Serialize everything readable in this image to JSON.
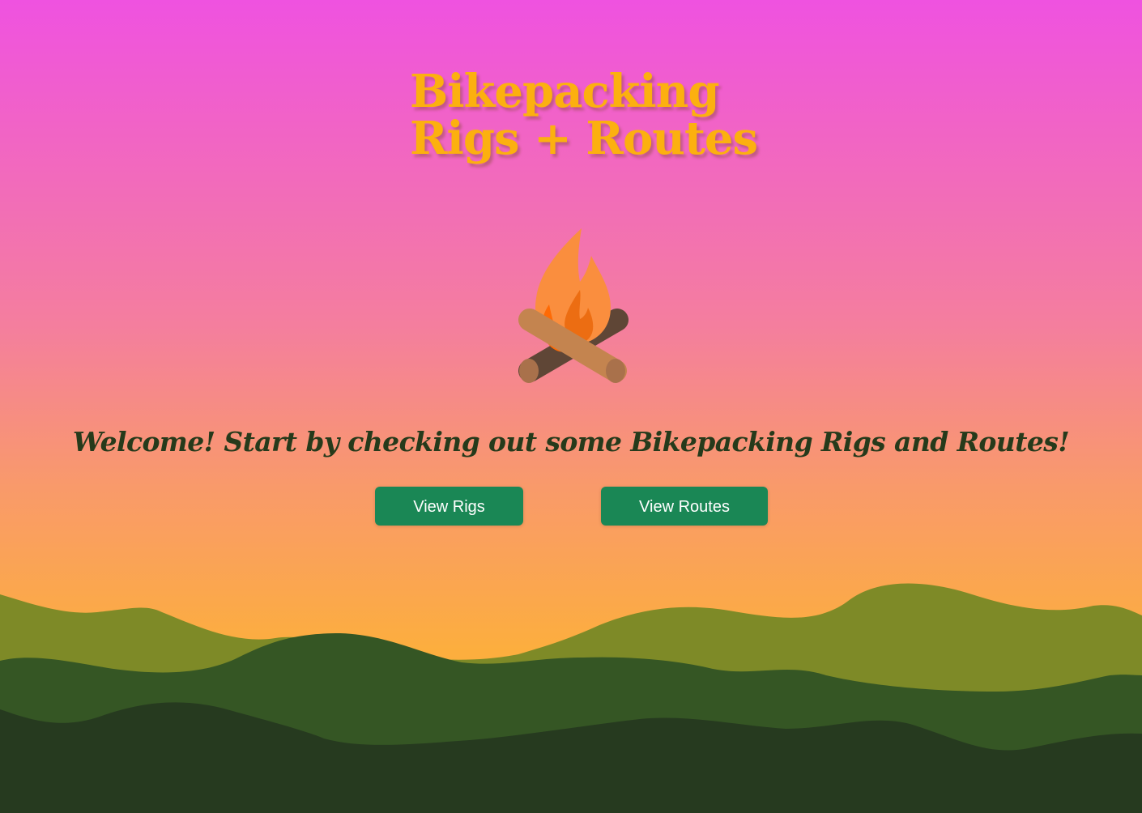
{
  "header": {
    "title_line1": "Bikepacking",
    "title_line2": "Rigs + Routes"
  },
  "hero": {
    "icon": "campfire-icon",
    "welcome_text": "Welcome! Start by checking out some Bikepacking Rigs and Routes!"
  },
  "actions": {
    "rigs_label": "View Rigs",
    "routes_label": "View Routes"
  },
  "colors": {
    "title": "#fcb00f",
    "button": "#1a8755",
    "welcome_text": "#263a1b",
    "sky_top": "#ef52e0",
    "sky_bottom": "#fcb23a",
    "hill_light": "#7e8a27",
    "hill_mid": "#355624",
    "hill_dark": "#263a1f"
  }
}
